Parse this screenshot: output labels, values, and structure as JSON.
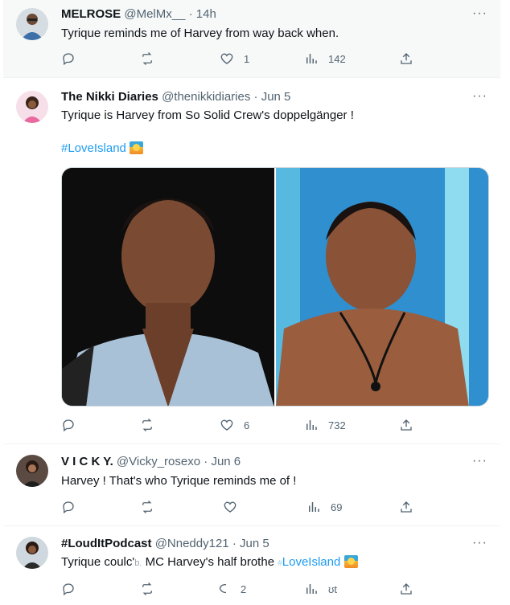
{
  "tweets": [
    {
      "name": "MELROSE",
      "handle": "@MelMx__",
      "dot": "·",
      "time": "14h",
      "text": "Tyrique reminds me of Harvey from way back when.",
      "likes": "1",
      "views": "142",
      "more": "···"
    },
    {
      "name": "The Nikki Diaries",
      "handle": "@thenikkidiaries",
      "dot": "·",
      "time": "Jun 5",
      "text": "Tyrique is Harvey from So Solid Crew's doppelgänger !",
      "hashtag": "#LoveIsland",
      "likes": "6",
      "views": "732",
      "more": "···"
    },
    {
      "name": "V I C K Y.",
      "handle": "@Vicky_rosexo",
      "dot": "·",
      "time": "Jun 6",
      "text": "Harvey ! That's who Tyrique reminds me of !",
      "views": "69",
      "more": "···"
    },
    {
      "name": "#LoudItPodcast",
      "handle": "@Nneddy121",
      "dot": "·",
      "time": "Jun 5",
      "text_before": "Tyrique coulc'",
      "text_obscured": "b.",
      "text_middle": "MC Harvey's half brothe",
      "text_obscured2": "#",
      "hashtag": "LoveIsland",
      "likes": "2",
      "views": "ʊt",
      "more": "···"
    }
  ],
  "colors": {
    "link": "#1d9bf0",
    "muted": "#536471",
    "text": "#0f1419",
    "highlight_bg": "#f7f9f9"
  },
  "icons": [
    "reply-icon",
    "retweet-icon",
    "like-icon",
    "views-icon",
    "share-icon",
    "more-icon"
  ]
}
